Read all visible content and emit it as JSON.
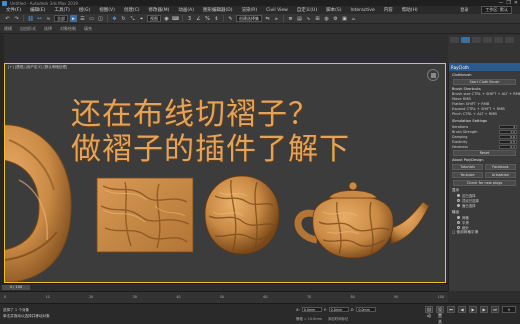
{
  "window": {
    "title": "Untitled - Autodesk 3ds Max 2019",
    "controls": [
      "—",
      "❐",
      "✕"
    ]
  },
  "menu": {
    "items": [
      "文件(F)",
      "编辑(E)",
      "工具(T)",
      "组(G)",
      "视图(V)",
      "创建(C)",
      "修改器(M)",
      "动画(A)",
      "图形编辑器(D)",
      "渲染(R)",
      "Civil View",
      "自定义(U)",
      "脚本(S)",
      "Interactive",
      "内容",
      "帮助(H)"
    ],
    "user": "登录",
    "workspace_label": "工作区: 默认"
  },
  "toolbar": {
    "filter": "全部",
    "view": "视图",
    "selection_set": "创建选择集"
  },
  "ribbon": {
    "tabs": [
      "建模",
      "自由形式",
      "选择",
      "对象绘制",
      "填充"
    ]
  },
  "viewport": {
    "label": "[+] [透视] [用户定义] [默认明暗处理]"
  },
  "overlay": {
    "line1": "还在布线切褶子？",
    "line2": "做褶子的插件了解下"
  },
  "panel": {
    "header": "RayCloth",
    "clothbrush": "Clothbrush",
    "start_btn": "Start Cloth Brush",
    "brush_shortcuts": "Brush Shortcuts",
    "shortcuts": [
      "Brush size  CTRL + SHIFT + ALT + RMB",
      "Move  RMB",
      "Flatten  SHIFT + RMB",
      "Expand  CTRL + SHIFT + RMB",
      "Pinch  CTRL + ALT + RMB"
    ],
    "sim_settings": "Simulation Settings",
    "params": [
      {
        "label": "Iterations",
        "value": "4"
      },
      {
        "label": "Brush Strength",
        "value": "1.0"
      },
      {
        "label": "Damping",
        "value": "0.6"
      },
      {
        "label": "Elasticity",
        "value": "0.5"
      },
      {
        "label": "Hardness",
        "value": "0.2"
      }
    ],
    "reset_btn": "Reset",
    "about": "About PolyDesign",
    "grid_buttons": [
      "Tutorials",
      "Facebook",
      "Youtube",
      "Artstation"
    ],
    "check_btn": "Check for new plugs",
    "display": "显示",
    "radios": [
      {
        "label": "边已选择",
        "on": true
      },
      {
        "label": "顶点已选择",
        "on": false
      },
      {
        "label": "面已选择",
        "on": true
      }
    ],
    "output": "输出",
    "radios2": [
      {
        "label": "网格",
        "on": true
      },
      {
        "label": "平滑",
        "on": false
      },
      {
        "label": "细分",
        "on": false
      }
    ],
    "extra": "□ 使用网格平滑"
  },
  "timeline": {
    "slider": "0 / 100",
    "ticks": [
      "0",
      "10",
      "20",
      "30",
      "40",
      "50",
      "60",
      "70",
      "80",
      "90",
      "100"
    ]
  },
  "status": {
    "line1": "选择了 1 个对象",
    "line2": "单击并拖动以选择并移动对象",
    "x_label": "X:",
    "x_value": "0.0mm",
    "y_label": "Y:",
    "y_value": "0.0mm",
    "z_label": "Z:",
    "z_value": "0.0mm",
    "grid": "栅格 = 10.0mm",
    "add_key": "添加时间标记",
    "auto": "自动",
    "set_key": "设置关键点",
    "frame": "0"
  },
  "colors": {
    "clay": "#c98a45",
    "text": "#e0a45e",
    "accent": "#3d6fa3",
    "viewport_border": "#f0c030"
  }
}
